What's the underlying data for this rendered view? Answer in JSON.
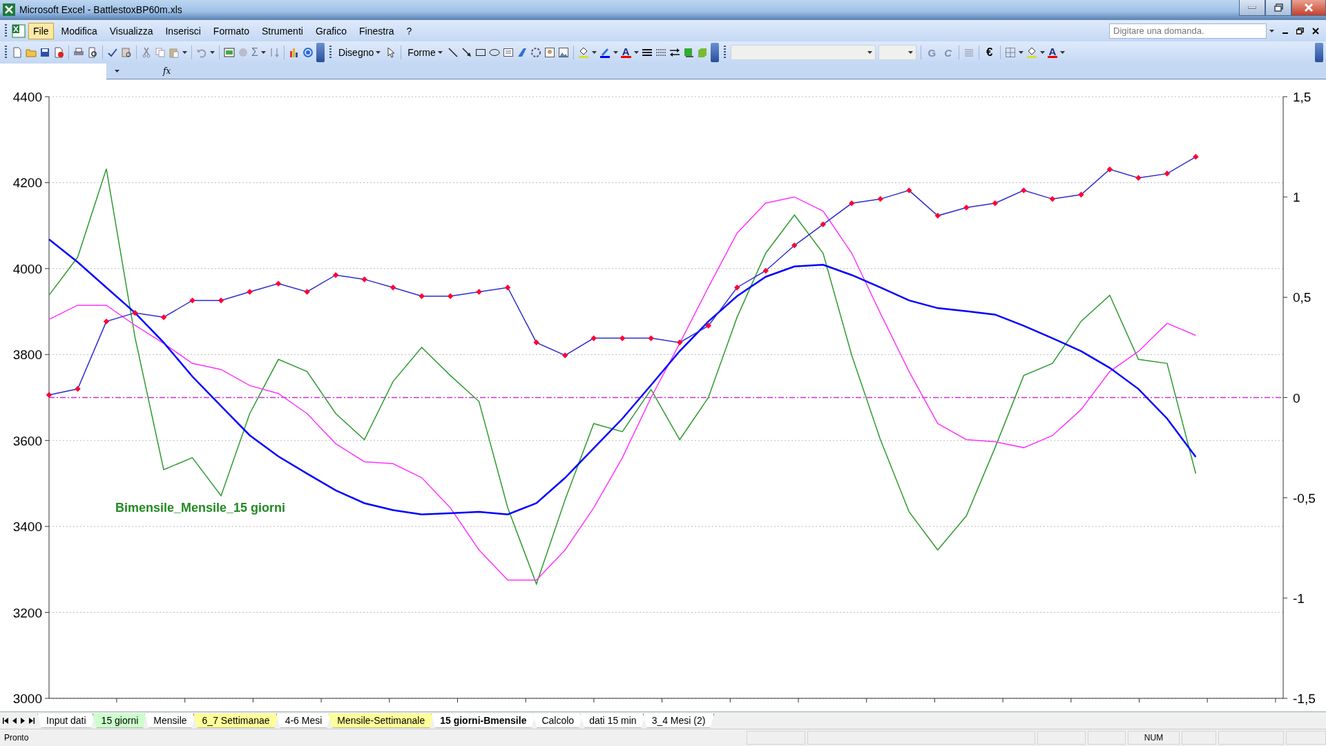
{
  "window": {
    "title": "Microsoft Excel - BattlestoxBP60m.xls"
  },
  "menu": {
    "items": [
      {
        "label": "File",
        "selected": true
      },
      {
        "label": "Modifica",
        "selected": false
      },
      {
        "label": "Visualizza",
        "selected": false
      },
      {
        "label": "Inserisci",
        "selected": false
      },
      {
        "label": "Formato",
        "selected": false
      },
      {
        "label": "Strumenti",
        "selected": false
      },
      {
        "label": "Grafico",
        "selected": false
      },
      {
        "label": "Finestra",
        "selected": false
      },
      {
        "label": "?",
        "selected": false
      }
    ],
    "help_search": {
      "placeholder": "Digitare una domanda."
    }
  },
  "toolbar": {
    "sum_glyph": "Σ",
    "draw_menu": "Disegno",
    "shapes_menu": "Forme",
    "font_color_letter": "A",
    "bold_label": "G",
    "italic_label": "C",
    "euro_glyph": "€",
    "font_color_letter_2": "A"
  },
  "formula_bar": {
    "fx_label": "fx"
  },
  "chart": {
    "chart_data": {
      "type": "line",
      "ylim": [
        3000,
        4400
      ],
      "yticks": [
        3000,
        3200,
        3400,
        3600,
        3800,
        4000,
        4200,
        4400
      ],
      "y2lim": [
        -1.5,
        1.5
      ],
      "y2ticks": [
        {
          "value": -1.5,
          "label": "-1,5"
        },
        {
          "value": -1,
          "label": "-1"
        },
        {
          "value": -0.5,
          "label": "-0,5"
        },
        {
          "value": 0,
          "label": "0"
        },
        {
          "value": 0.5,
          "label": "0,5"
        },
        {
          "value": 1,
          "label": "1"
        },
        {
          "value": 1.5,
          "label": "1,5"
        }
      ],
      "series": [
        {
          "color": "#2b2bd0",
          "marker": "diamond",
          "values": [
            3706,
            3720,
            3877,
            3897,
            3887,
            3926,
            3926,
            3946,
            3965,
            3946,
            3985,
            3975,
            3956,
            3936,
            3936,
            3946,
            3956,
            3828,
            3798,
            3838,
            3838,
            3838,
            3828,
            3867,
            3956,
            3995,
            4054,
            4103,
            4152,
            4162,
            4182,
            4123,
            4142,
            4152,
            4182,
            4162,
            4172,
            4231,
            4211,
            4221,
            4260
          ]
        },
        {
          "color": "#0000ff",
          "values": [
            4068,
            4015,
            3956,
            3897,
            3828,
            3749,
            3680,
            3612,
            3563,
            3523,
            3484,
            3454,
            3438,
            3428,
            3431,
            3434,
            3428,
            3454,
            3513,
            3582,
            3651,
            3729,
            3808,
            3877,
            3936,
            3981,
            4005,
            4009,
            3985,
            3956,
            3926,
            3908,
            3901,
            3893,
            3867,
            3838,
            3808,
            3769,
            3720,
            3651,
            3562
          ]
        },
        {
          "color": "#ff33ff",
          "axis": "y2",
          "values": [
            0.39,
            0.46,
            0.46,
            0.36,
            0.27,
            0.17,
            0.14,
            0.06,
            0.02,
            -0.08,
            -0.23,
            -0.32,
            -0.33,
            -0.4,
            -0.55,
            -0.76,
            -0.91,
            -0.91,
            -0.76,
            -0.55,
            -0.3,
            0,
            0.27,
            0.55,
            0.82,
            0.97,
            1.0,
            0.93,
            0.72,
            0.42,
            0.13,
            -0.13,
            -0.21,
            -0.22,
            -0.25,
            -0.19,
            -0.06,
            0.13,
            0.23,
            0.37,
            0.31
          ]
        },
        {
          "color": "#2e9a2e",
          "axis": "y2",
          "values": [
            0.51,
            0.7,
            1.14,
            0.3,
            -0.36,
            -0.3,
            -0.49,
            -0.08,
            0.19,
            0.13,
            -0.08,
            -0.21,
            0.08,
            0.25,
            0.11,
            -0.02,
            -0.55,
            -0.93,
            -0.51,
            -0.13,
            -0.17,
            0.04,
            -0.21,
            0,
            0.4,
            0.72,
            0.91,
            0.72,
            0.21,
            -0.21,
            -0.57,
            -0.76,
            -0.59,
            -0.25,
            0.11,
            0.17,
            0.38,
            0.51,
            0.19,
            0.17,
            -0.38
          ]
        }
      ],
      "ref_lines": [
        {
          "value": 0,
          "axis": "y2",
          "color": "#cc33cc"
        }
      ],
      "grid": true,
      "annotations": [
        "Bimensile_Mensile_15 giorni"
      ]
    }
  },
  "sheet_tabs": [
    {
      "label": "Input dati",
      "selected": false
    },
    {
      "label": "15 giorni",
      "selected": false,
      "color": "#ccffcc"
    },
    {
      "label": "Mensile",
      "selected": false
    },
    {
      "label": "6_7 Settimanae",
      "selected": false,
      "color": "#ffff99"
    },
    {
      "label": "4-6 Mesi",
      "selected": false
    },
    {
      "label": "Mensile-Settimanale",
      "selected": false,
      "color": "#ffff99"
    },
    {
      "label": "15 giorni-Bmensile",
      "selected": true
    },
    {
      "label": "Calcolo",
      "selected": false
    },
    {
      "label": "dati 15 min",
      "selected": false
    },
    {
      "label": "3_4 Mesi (2)",
      "selected": false
    }
  ],
  "status_bar": {
    "message": "Pronto",
    "num_lock": "NUM"
  }
}
